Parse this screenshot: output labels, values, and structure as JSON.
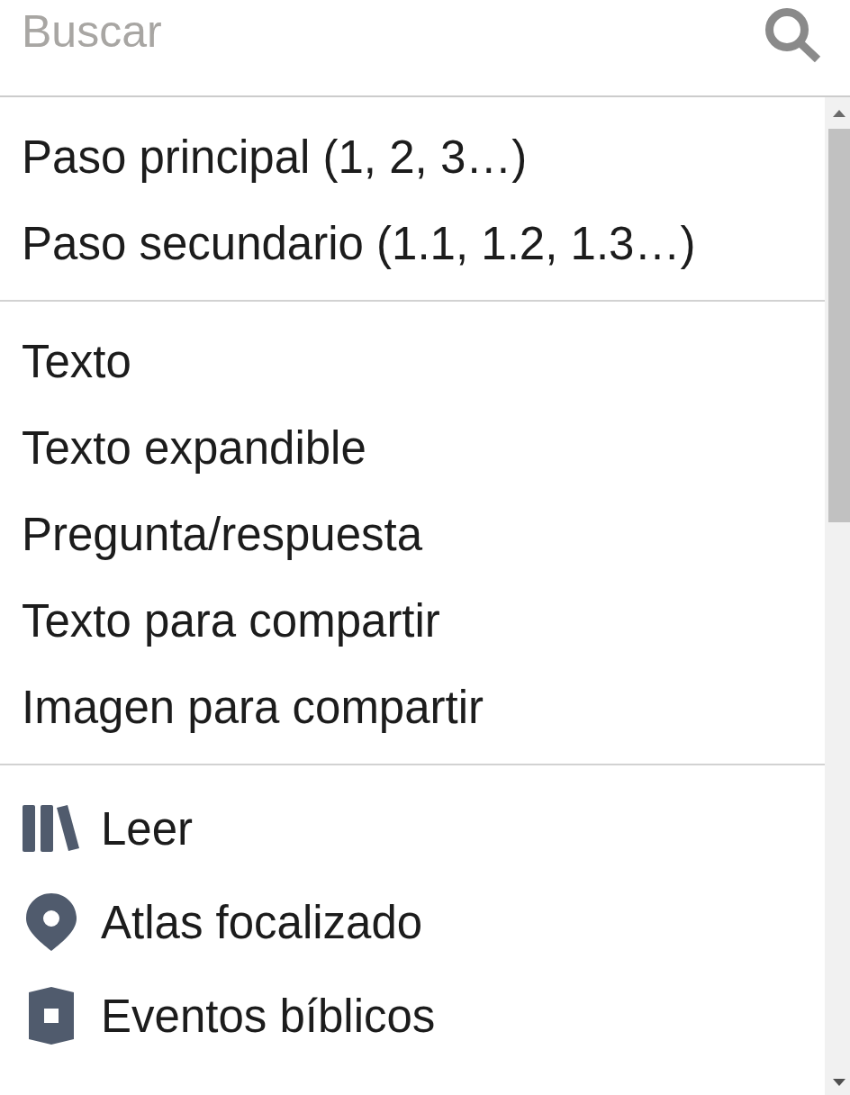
{
  "search": {
    "placeholder": "Buscar"
  },
  "sections": [
    {
      "items": [
        {
          "label": "Paso principal (1, 2, 3…)"
        },
        {
          "label": "Paso secundario (1.1, 1.2, 1.3…)"
        }
      ]
    },
    {
      "items": [
        {
          "label": "Texto"
        },
        {
          "label": "Texto expandible"
        },
        {
          "label": "Pregunta/respuesta"
        },
        {
          "label": "Texto para compartir"
        },
        {
          "label": "Imagen para compartir"
        }
      ]
    },
    {
      "items": [
        {
          "label": "Leer",
          "kind": "books"
        },
        {
          "label": "Atlas focalizado",
          "kind": "pin"
        },
        {
          "label": "Eventos bíblicos",
          "kind": "shield"
        }
      ]
    }
  ]
}
